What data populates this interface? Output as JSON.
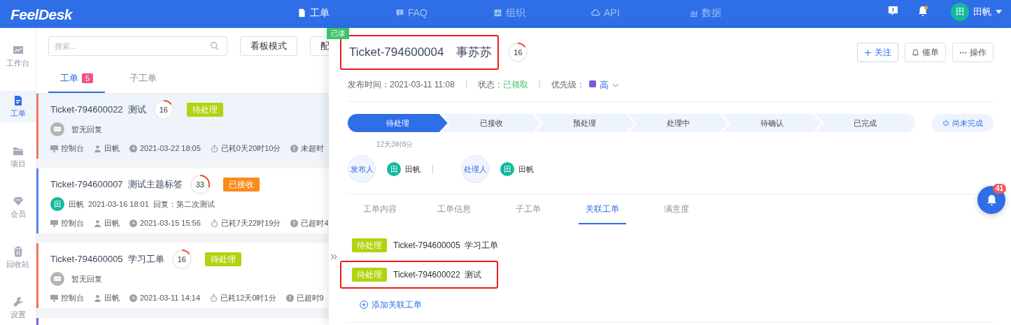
{
  "topbar": {
    "logo": "FeelDesk",
    "nav": [
      {
        "label": "工单",
        "selected": true
      },
      {
        "label": "FAQ",
        "selected": false
      },
      {
        "label": "组织",
        "selected": false
      },
      {
        "label": "API",
        "selected": false
      },
      {
        "label": "数据",
        "selected": false
      }
    ],
    "user": {
      "avatar": "田",
      "name": "田帆"
    }
  },
  "sidebar": {
    "items": [
      {
        "label": "工作台",
        "selected": false
      },
      {
        "label": "工单",
        "selected": true
      },
      {
        "label": "项目",
        "selected": false
      },
      {
        "label": "会员",
        "selected": false
      },
      {
        "label": "回收站",
        "selected": false
      },
      {
        "label": "设置",
        "selected": false
      }
    ]
  },
  "list": {
    "search": {
      "placeholder": "搜索..."
    },
    "buttons": [
      "看板模式",
      "配"
    ],
    "tabs": [
      {
        "label": "工单",
        "badge": "5",
        "selected": true
      },
      {
        "label": "子工单",
        "selected": false
      }
    ],
    "tickets": [
      {
        "id": "Ticket-794600022",
        "title": "测试",
        "count": "16",
        "level": 0.15,
        "status": {
          "label": "待处理",
          "color": "#b3d20f"
        },
        "color": "#f0775f",
        "selected": true,
        "reply": {
          "kind": "none",
          "text": "暂无回复"
        },
        "meta": {
          "source": "控制台",
          "user": "田帆",
          "time": "2021-03-22 18:05",
          "elapsed": "已耗0天20时10分",
          "overdue": "未超时"
        }
      },
      {
        "id": "Ticket-794600007",
        "title": "测试主题标签",
        "count": "33",
        "level": 0.3,
        "status": {
          "label": "已接收",
          "color": "#fa8a1a"
        },
        "color": "#5b86ee",
        "selected": false,
        "reply": {
          "kind": "reply",
          "avatar": "田",
          "author": "田帆",
          "time": "2021-03-16 18:01",
          "text": "回复：第二次测试"
        },
        "meta": {
          "source": "控制台",
          "user": "田帆",
          "time": "2021-03-15 15:56",
          "elapsed": "已耗7天22时19分",
          "overdue": "已超时4"
        }
      },
      {
        "id": "Ticket-794600005",
        "title": "学习工单",
        "count": "16",
        "level": 0.15,
        "status": {
          "label": "待处理",
          "color": "#b3d20f"
        },
        "color": "#f0775f",
        "selected": false,
        "reply": {
          "kind": "none",
          "text": "暂无回复"
        },
        "meta": {
          "source": "控制台",
          "user": "田帆",
          "time": "2021-03-11 14:14",
          "elapsed": "已耗12天0时1分",
          "overdue": "已超时9"
        }
      },
      {
        "color": "#8a5cdc",
        "selected": false
      }
    ]
  },
  "drawer": {
    "read_tag": "已读",
    "title": {
      "id": "Ticket-794600004",
      "name": "事苏苏",
      "highlighted": true
    },
    "count": "16",
    "level": 0.15,
    "actions": [
      {
        "label": "关注"
      },
      {
        "label": "催单"
      },
      {
        "label": "操作"
      }
    ],
    "meta": {
      "published_label": "发布时间：",
      "published": "2021-03-11 11:08",
      "status_label": "状态：",
      "status": "已领取",
      "priority_label": "优先级：",
      "priority": {
        "label": "高",
        "color": "#7b5cd6"
      }
    },
    "steps": [
      {
        "label": "待处理",
        "selected": true
      },
      {
        "label": "已接收",
        "selected": false
      },
      {
        "label": "预处理",
        "selected": false
      },
      {
        "label": "处理中",
        "selected": false
      },
      {
        "label": "待确认",
        "selected": false
      },
      {
        "label": "已完成",
        "selected": false
      }
    ],
    "step_duration": "12天3时8分",
    "complete_button": "尚未完成",
    "people": [
      {
        "role": "发布人",
        "avatar": "田",
        "name": "田帆"
      },
      {
        "role": "处理人",
        "avatar": "田",
        "name": "田帆"
      }
    ],
    "tabs": [
      {
        "label": "工单内容",
        "selected": false
      },
      {
        "label": "工单信息",
        "selected": false
      },
      {
        "label": "子工单",
        "selected": false
      },
      {
        "label": "关联工单",
        "selected": true
      },
      {
        "label": "满意度",
        "selected": false
      }
    ],
    "related": [
      {
        "status": "待处理",
        "color": "#b3d20f",
        "id": "Ticket-794600005",
        "title": "学习工单",
        "highlighted": false
      },
      {
        "status": "待处理",
        "color": "#b3d20f",
        "id": "Ticket-794600022",
        "title": "测试",
        "highlighted": true
      }
    ],
    "add_link": "添加关联工单",
    "collapse_handle": "»"
  },
  "float_button": {
    "badge": "41"
  }
}
